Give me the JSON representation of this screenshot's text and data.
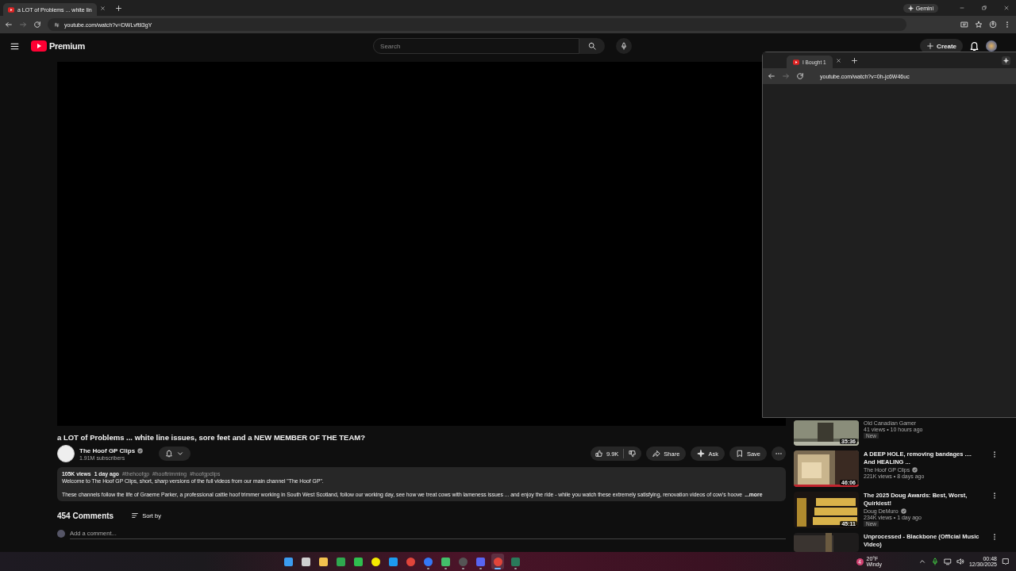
{
  "browser": {
    "tabs": [
      {
        "title": "a LOT of Problems ... white lin",
        "selected": true
      }
    ],
    "gemini": "Gemini",
    "url": "youtube.com/watch?v=DWLvftli3gY"
  },
  "header": {
    "logo": "Premium",
    "search": {
      "placeholder": "Search"
    },
    "create": "Create"
  },
  "video": {
    "title": "a LOT of Problems ... white line issues, sore feet and a NEW MEMBER OF THE TEAM?",
    "channel": {
      "name": "The Hoof GP Clips",
      "verified": true,
      "subscribers": "1.91M subscribers"
    },
    "likes": "9.9K",
    "share": "Share",
    "ask": "Ask",
    "save": "Save"
  },
  "description": {
    "views": "105K views",
    "age": "1 day ago",
    "hashtags": [
      "#thehoofgp",
      "#hooftrimming",
      "#hoofgpclips"
    ],
    "lines": [
      "Welcome to The Hoof GP Clips, short, sharp versions of the full videos from our main channel \"The Hoof GP\".",
      "These channels follow the life of Graeme Parker, a professional cattle hoof trimmer working in South West Scotland, follow our working day, see how we treat cows with lameness issues ... and enjoy the ride - while you watch these extremely satisfying, renovation videos of cow's hoove"
    ],
    "more": "...more"
  },
  "comments": {
    "count": "454 Comments",
    "sort": "Sort by",
    "add": {
      "placeholder": "Add a comment..."
    }
  },
  "recommended": [
    {
      "channel": "Old Canadian Gamer",
      "verified": false,
      "stats": "41 views • 10 hours ago",
      "badge": "New",
      "duration": "35:36"
    },
    {
      "title": "A DEEP HOLE, removing bandages .... And HEALING ...",
      "channel": "The Hoof GP Clips",
      "verified": true,
      "stats": "221K views • 8 days ago",
      "duration": "46:06"
    },
    {
      "title": "The 2025 Doug Awards: Best, Worst, Quirkiest!",
      "channel": "Doug DeMuro",
      "verified": true,
      "stats": "234K views • 1 day ago",
      "badge": "New",
      "duration": "45:11"
    },
    {
      "title": "Unprocessed - Blackbone (Official Music Video)"
    }
  ],
  "popup": {
    "tab": "I Bought 1",
    "url": "youtube.com/watch?v=0h-jc6W46uc"
  },
  "taskbar": {
    "apps": [
      {
        "kind": "start",
        "running": false,
        "selected": false
      },
      {
        "kind": "taskview",
        "running": false,
        "selected": false
      },
      {
        "kind": "folder",
        "running": false,
        "selected": false
      },
      {
        "kind": "xbox",
        "running": false,
        "selected": false
      },
      {
        "kind": "sheets",
        "running": false,
        "selected": false
      },
      {
        "kind": "snap",
        "running": false,
        "selected": false
      },
      {
        "kind": "bird",
        "running": false,
        "selected": false
      },
      {
        "kind": "chrome",
        "running": false,
        "selected": false
      },
      {
        "kind": "chat",
        "running": true,
        "selected": false
      },
      {
        "kind": "play",
        "running": true,
        "selected": false
      },
      {
        "kind": "obs",
        "running": true,
        "selected": false
      },
      {
        "kind": "discord",
        "running": true,
        "selected": false
      },
      {
        "kind": "chrome",
        "running": true,
        "selected": true
      },
      {
        "kind": "terminal",
        "running": true,
        "selected": false
      }
    ],
    "weather": {
      "badge": "4",
      "temp": "20°F",
      "condition": "Windy"
    },
    "time": "00:48",
    "date": "12/30/2025"
  }
}
